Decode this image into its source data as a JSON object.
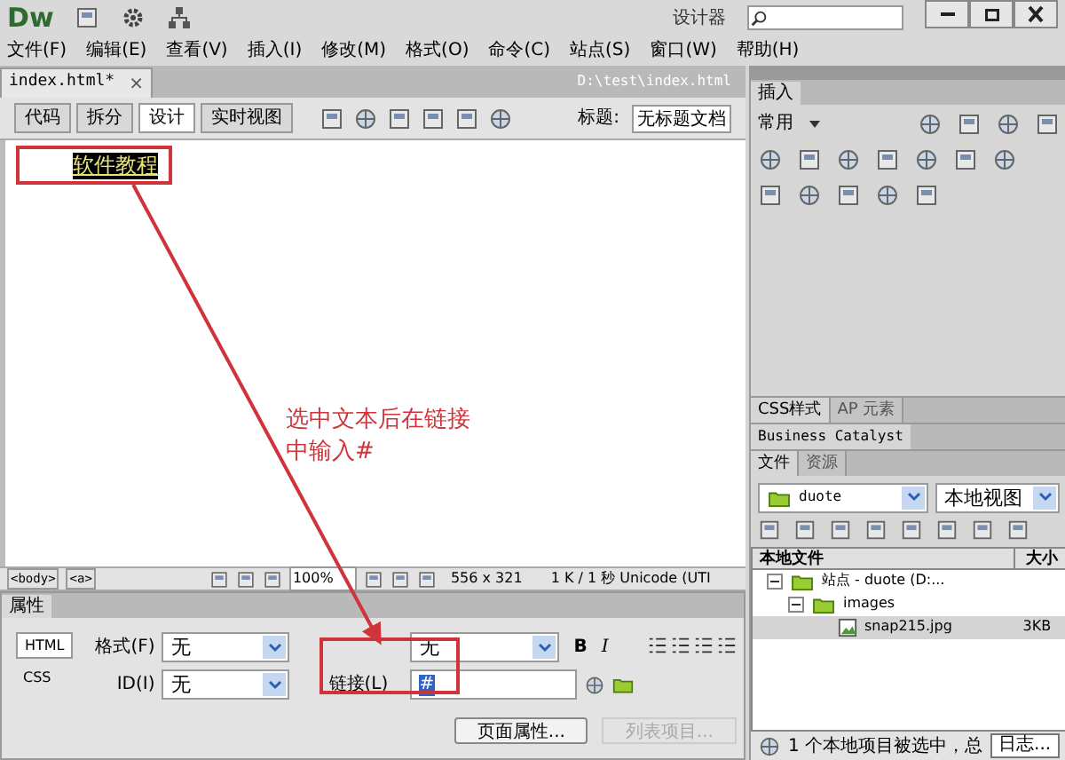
{
  "title_bar": {
    "logo": "Dw",
    "workspace": "设计器"
  },
  "menu": [
    "文件(F)",
    "编辑(E)",
    "查看(V)",
    "插入(I)",
    "修改(M)",
    "格式(O)",
    "命令(C)",
    "站点(S)",
    "窗口(W)",
    "帮助(H)"
  ],
  "document_tab": {
    "label": "index.html*",
    "close": "×",
    "path": "D:\\test\\index.html"
  },
  "view_buttons": [
    {
      "label": "代码",
      "selected": false
    },
    {
      "label": "拆分",
      "selected": false
    },
    {
      "label": "设计",
      "selected": true
    },
    {
      "label": "实时视图",
      "selected": false
    }
  ],
  "title_field": {
    "label": "标题:",
    "value": "无标题文档"
  },
  "design": {
    "selected_text": "软件教程",
    "annotation": "选中文本后在链接中输入#"
  },
  "status_bar": {
    "tags": [
      "<body>",
      "<a>"
    ],
    "zoom": "100%",
    "size": "556 x 321",
    "info": "1 K / 1 秒 Unicode (UTI"
  },
  "properties": {
    "tab": "属性",
    "modes": [
      {
        "label": "HTML",
        "selected": true
      },
      {
        "label": "CSS",
        "selected": false
      }
    ],
    "format": {
      "label": "格式(F)",
      "value": "无"
    },
    "id": {
      "label": "ID(I)",
      "value": "无"
    },
    "class_value": "无",
    "bold": "B",
    "italic": "I",
    "link": {
      "label": "链接(L)",
      "value": "#"
    },
    "buttons": [
      {
        "label": "页面属性...",
        "disabled": false
      },
      {
        "label": "列表项目...",
        "disabled": true
      }
    ]
  },
  "insert_panel": {
    "tab": "插入",
    "category": "常用"
  },
  "css_tabs": [
    {
      "label": "CSS样式",
      "selected": true
    },
    {
      "label": "AP 元素",
      "selected": false
    }
  ],
  "bc_tab": "Business Catalyst",
  "files_tabs": [
    {
      "label": "文件",
      "selected": true
    },
    {
      "label": "资源",
      "selected": false
    }
  ],
  "site_select": "duote",
  "view_select": "本地视图",
  "file_columns": [
    "本地文件",
    "大小"
  ],
  "files": [
    {
      "name": "站点 - duote (D:...",
      "expanded": true,
      "selected": false,
      "children": [
        {
          "name": "images",
          "expanded": true,
          "selected": false,
          "children": [
            {
              "name": "snap215.jpg",
              "size": "3KB",
              "selected": true
            }
          ]
        }
      ]
    }
  ],
  "status": "1 个本地项目被选中，总",
  "log_button": "日志..."
}
